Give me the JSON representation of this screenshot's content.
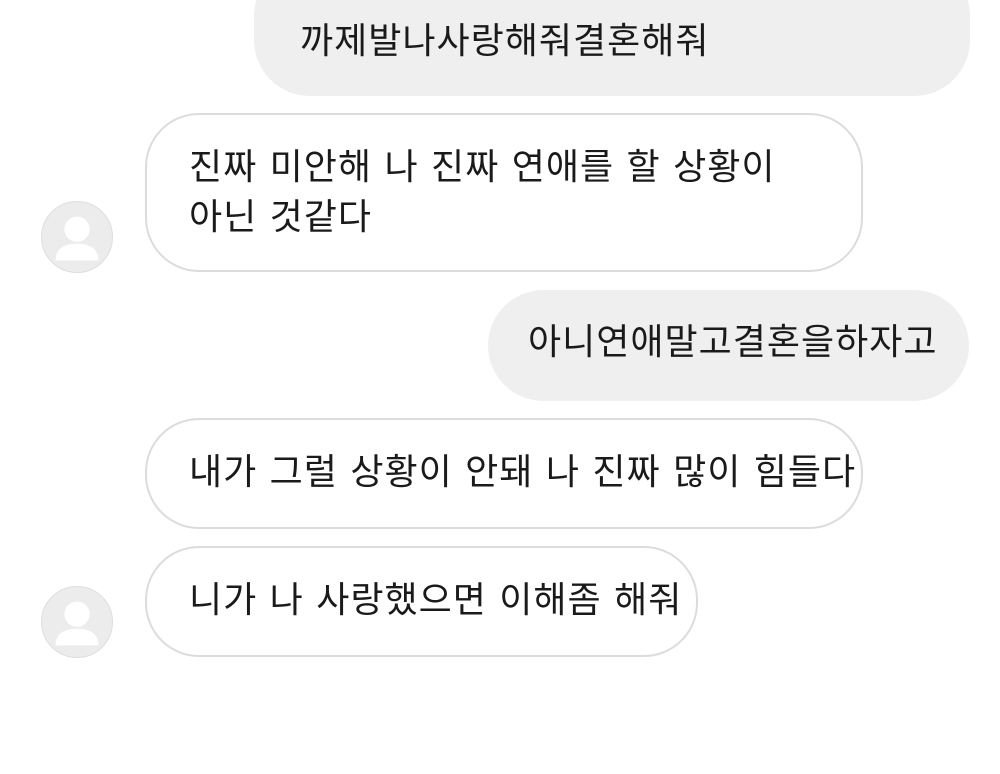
{
  "messages": [
    {
      "sender": "me",
      "text": "까제발나사랑해줘결혼해줘"
    },
    {
      "sender": "other",
      "text": "진짜 미안해 나 진짜 연애를 할 상황이 아닌 것같다"
    },
    {
      "sender": "me",
      "text": "아니연애말고결혼을하자고"
    },
    {
      "sender": "other",
      "text": "내가 그럴 상황이 안돼 나 진짜 많이 힘들다"
    },
    {
      "sender": "other",
      "text": "니가 나 사랑했으면 이해좀 해줘"
    }
  ],
  "colors": {
    "sent_bubble": "#efefef",
    "received_bubble_border": "#dcdcdc",
    "avatar_bg": "#ececec",
    "avatar_icon": "#ffffff"
  },
  "icons": {
    "avatar": "default-profile-icon"
  }
}
